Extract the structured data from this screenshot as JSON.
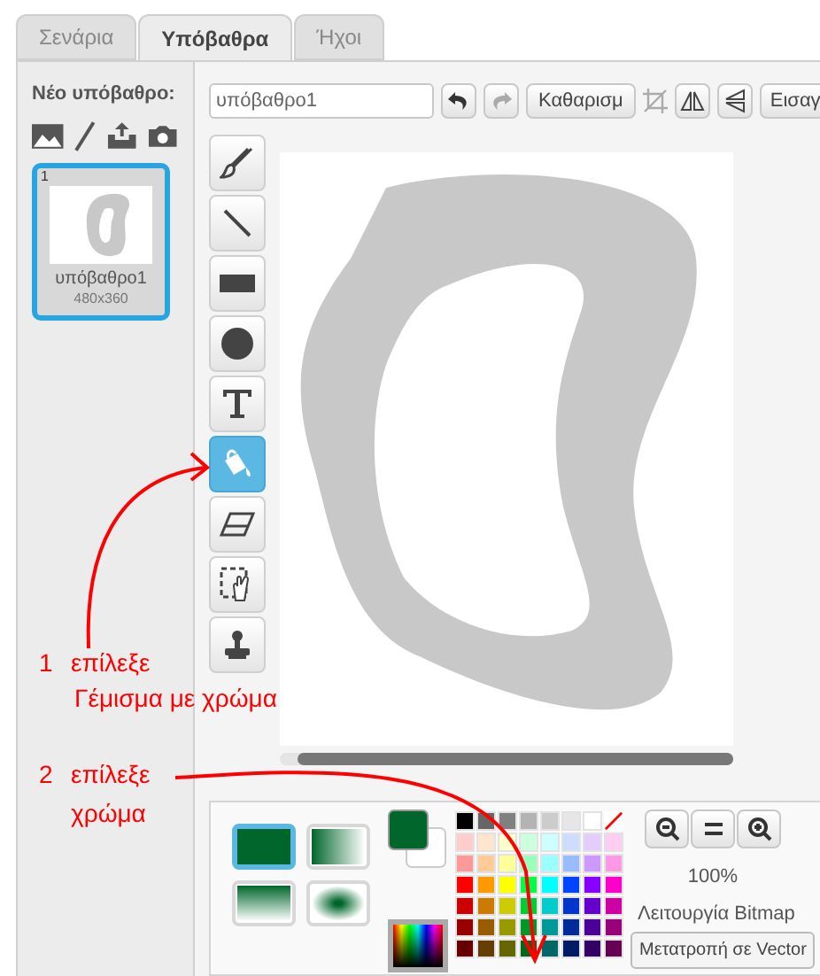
{
  "tabs": [
    {
      "label": "Σενάρια",
      "selected": false
    },
    {
      "label": "Υπόβαθρα",
      "selected": true
    },
    {
      "label": "Ήχοι",
      "selected": false
    }
  ],
  "sidebar": {
    "heading": "Νέο υπόβαθρο:",
    "backdrops": [
      {
        "index": "1",
        "name": "υπόβαθρο1",
        "size": "480x360",
        "selected": true
      }
    ]
  },
  "toolbar": {
    "name_field": {
      "value": "υπόβαθρο1"
    },
    "clear_button": "Καθαρισμ",
    "import_button": "Εισαγ"
  },
  "tools": [
    {
      "kind": "brush",
      "selected": false
    },
    {
      "kind": "line",
      "selected": false
    },
    {
      "kind": "rectangle",
      "selected": false
    },
    {
      "kind": "ellipse",
      "selected": false
    },
    {
      "kind": "text",
      "selected": false
    },
    {
      "kind": "fill",
      "selected": true
    },
    {
      "kind": "eraser",
      "selected": false
    },
    {
      "kind": "select",
      "selected": false
    },
    {
      "kind": "stamp",
      "selected": false
    }
  ],
  "fill_styles": [
    {
      "kind": "solid",
      "selected": true
    },
    {
      "kind": "horizontal",
      "selected": false
    },
    {
      "kind": "vertical",
      "selected": false
    },
    {
      "kind": "radial",
      "selected": false
    }
  ],
  "palette": {
    "no_color_swatch": true,
    "rows": [
      {
        "swatches": [
          {
            "color": "#000000"
          },
          {
            "color": "#666666"
          },
          {
            "color": "#808080"
          },
          {
            "color": "#b3b3b3"
          },
          {
            "color": "#cccccc"
          },
          {
            "color": "#e6e6e6"
          },
          {
            "color": "#ffffff"
          }
        ]
      },
      {
        "swatches": [
          {
            "color": "#ffcccc"
          },
          {
            "color": "#ffe5cc"
          },
          {
            "color": "#ffffcc"
          },
          {
            "color": "#ccffdd"
          },
          {
            "color": "#ccffff"
          },
          {
            "color": "#ccddff"
          },
          {
            "color": "#e5ccff"
          },
          {
            "color": "#ffccf2"
          }
        ]
      },
      {
        "swatches": [
          {
            "color": "#ff9999"
          },
          {
            "color": "#ffcc99"
          },
          {
            "color": "#ffff99"
          },
          {
            "color": "#99ffbb"
          },
          {
            "color": "#99ffff"
          },
          {
            "color": "#99bbff"
          },
          {
            "color": "#cc99ff"
          },
          {
            "color": "#ff99e6"
          }
        ]
      },
      {
        "swatches": [
          {
            "color": "#ff0000"
          },
          {
            "color": "#ff9900"
          },
          {
            "color": "#ffff00"
          },
          {
            "color": "#00ff44"
          },
          {
            "color": "#00ffff"
          },
          {
            "color": "#0044ff"
          },
          {
            "color": "#8800ff"
          },
          {
            "color": "#ff00cc"
          }
        ]
      },
      {
        "swatches": [
          {
            "color": "#cc0000"
          },
          {
            "color": "#cc7a00"
          },
          {
            "color": "#cccc00"
          },
          {
            "color": "#00cc36"
          },
          {
            "color": "#00cccc"
          },
          {
            "color": "#0036cc"
          },
          {
            "color": "#6600cc"
          },
          {
            "color": "#cc00a3"
          }
        ]
      },
      {
        "swatches": [
          {
            "color": "#990000"
          },
          {
            "color": "#995c00"
          },
          {
            "color": "#999900"
          },
          {
            "color": "#009929"
          },
          {
            "color": "#009999"
          },
          {
            "color": "#002999"
          },
          {
            "color": "#4c0099"
          },
          {
            "color": "#99007a"
          }
        ]
      },
      {
        "swatches": [
          {
            "color": "#660000"
          },
          {
            "color": "#663d00"
          },
          {
            "color": "#666600"
          },
          {
            "color": "#00661b"
          },
          {
            "color": "#006666"
          },
          {
            "color": "#001b66"
          },
          {
            "color": "#330066"
          },
          {
            "color": "#660052"
          }
        ]
      }
    ]
  },
  "zoom": {
    "level_text": "100%"
  },
  "mode_label": "Λειτουργία Bitmap",
  "tooltip": "Μετατροπή σε Vector",
  "annotations": [
    {
      "number": "1",
      "text": "επίλεξε",
      "detail": "Γέμισμα με χρώμα"
    },
    {
      "number": "2",
      "text": "επίλεξε",
      "detail": "χρώμα"
    }
  ]
}
